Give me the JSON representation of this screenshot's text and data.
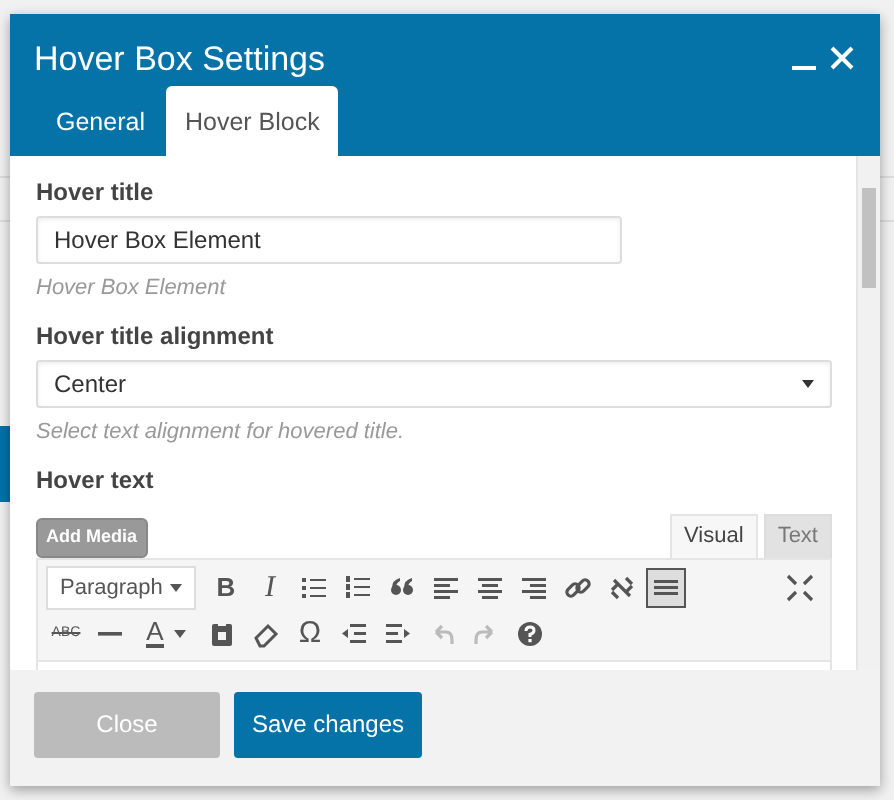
{
  "window": {
    "title": "Hover Box Settings"
  },
  "title_buttons": [
    {
      "kind": "minimize"
    },
    {
      "kind": "close"
    }
  ],
  "tabs": [
    {
      "label": "General",
      "selected": false
    },
    {
      "label": "Hover Block",
      "selected": true
    }
  ],
  "fields": [
    {
      "kind": "text",
      "label": "Hover title",
      "value": "Hover Box Element",
      "help": "Hover Box Element"
    },
    {
      "kind": "select",
      "label": "Hover title alignment",
      "value": "Center",
      "help": "Select text alignment for hovered title."
    }
  ],
  "editor": {
    "label": "Hover text",
    "add_media": "Add Media",
    "modes": [
      {
        "label": "Visual",
        "selected": true
      },
      {
        "label": "Text",
        "selected": false
      }
    ],
    "format": "Paragraph",
    "toolbar_rows": [
      [
        {
          "kind": "bold",
          "label": "B"
        },
        {
          "kind": "italic",
          "label": "I"
        },
        {
          "kind": "bullets"
        },
        {
          "kind": "numbers"
        },
        {
          "kind": "quote"
        },
        {
          "kind": "alignleft"
        },
        {
          "kind": "aligncenter"
        },
        {
          "kind": "alignright"
        },
        {
          "kind": "link"
        },
        {
          "kind": "unlink"
        },
        {
          "kind": "toggle",
          "active": true
        },
        {
          "kind": "fullscreen"
        }
      ],
      [
        {
          "kind": "strike",
          "label": "ABC"
        },
        {
          "kind": "rule"
        },
        {
          "kind": "color",
          "label": "A"
        },
        {
          "kind": "paste"
        },
        {
          "kind": "eraser"
        },
        {
          "kind": "omega",
          "label": "Ω"
        },
        {
          "kind": "outdent"
        },
        {
          "kind": "indent"
        },
        {
          "kind": "undo",
          "disabled": true
        },
        {
          "kind": "redo",
          "disabled": true
        },
        {
          "kind": "help"
        }
      ]
    ]
  },
  "buttons": [
    {
      "kind": "secondary",
      "label": "Close"
    },
    {
      "kind": "primary",
      "label": "Save changes"
    }
  ]
}
